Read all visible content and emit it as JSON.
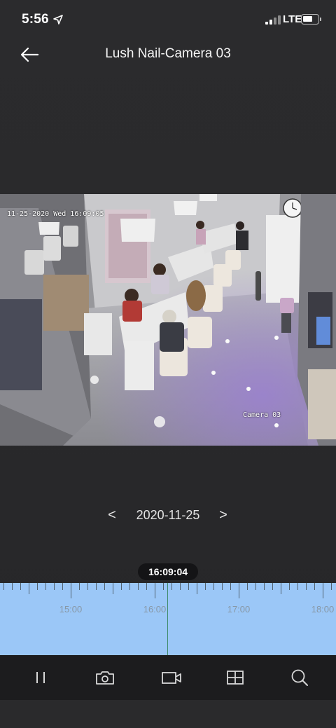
{
  "status_bar": {
    "time": "5:56",
    "network": "LTE",
    "icons": [
      "location-arrow-icon",
      "signal-bars-icon",
      "battery-icon"
    ]
  },
  "header": {
    "title": "Lush Nail-Camera 03",
    "back_icon": "back-arrow-icon"
  },
  "video": {
    "osd_timestamp": "11-25-2020 Wed 16:09:05",
    "osd_camera": "Camera 03"
  },
  "date_nav": {
    "prev": "<",
    "date": "2020-11-25",
    "next": ">"
  },
  "timeline": {
    "current_time": "16:09:04",
    "labels": [
      "15:00",
      "16:00",
      "17:00",
      "18:00"
    ],
    "colors": {
      "track": "#9bc7f7",
      "playhead": "#3f8b6b"
    }
  },
  "toolbar": {
    "icons": [
      "pause-icon",
      "snapshot-camera-icon",
      "record-video-icon",
      "grid-layout-icon",
      "zoom-search-icon"
    ]
  }
}
